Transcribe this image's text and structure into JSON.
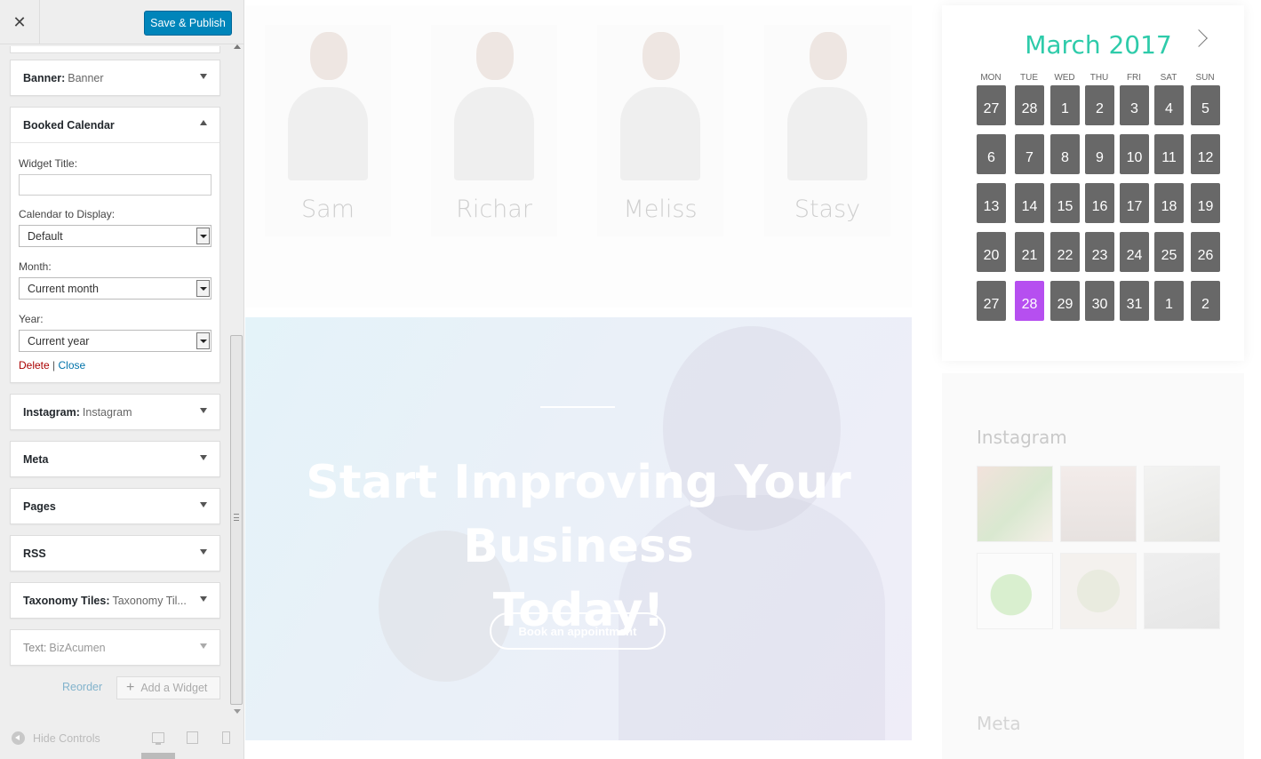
{
  "sidebar": {
    "close_symbol": "✕",
    "publish_label": "Save & Publish",
    "widgets": [
      {
        "title": "Banner:",
        "subtitle": "Banner"
      },
      {
        "title": "Booked Calendar",
        "subtitle": ""
      },
      {
        "title": "Instagram:",
        "subtitle": "Instagram"
      },
      {
        "title": "Meta",
        "subtitle": ""
      },
      {
        "title": "Pages",
        "subtitle": ""
      },
      {
        "title": "RSS",
        "subtitle": ""
      },
      {
        "title": "Taxonomy Tiles:",
        "subtitle": "Taxonomy Til..."
      },
      {
        "title": "Text:",
        "subtitle": "BizAcumen"
      }
    ],
    "booked_form": {
      "widget_title_label": "Widget Title:",
      "widget_title_value": "",
      "calendar_label": "Calendar to Display:",
      "calendar_value": "Default",
      "month_label": "Month:",
      "month_value": "Current month",
      "year_label": "Year:",
      "year_value": "Current year",
      "delete_label": "Delete",
      "separator": "|",
      "close_label": "Close"
    },
    "reorder_label": "Reorder",
    "add_widget_label": "Add a Widget",
    "add_widget_symbol": "+",
    "hide_controls_label": "Hide Controls"
  },
  "preview": {
    "team": [
      "Sam",
      "Richar",
      "Meliss",
      "Stasy"
    ],
    "hero": {
      "title_line1": "Start Improving Your Business",
      "title_line2": "Today!",
      "button_label": "Book an appointment"
    },
    "calendar": {
      "month_title": "March 2017",
      "weekdays": [
        "MON",
        "TUE",
        "WED",
        "THU",
        "FRI",
        "SAT",
        "SUN"
      ],
      "weeks": [
        [
          "27",
          "28",
          "1",
          "2",
          "3",
          "4",
          "5"
        ],
        [
          "6",
          "7",
          "8",
          "9",
          "10",
          "11",
          "12"
        ],
        [
          "13",
          "14",
          "15",
          "16",
          "17",
          "18",
          "19"
        ],
        [
          "20",
          "21",
          "22",
          "23",
          "24",
          "25",
          "26"
        ],
        [
          "27",
          "28",
          "29",
          "30",
          "31",
          "1",
          "2"
        ]
      ],
      "selected_day": "28",
      "selected_color": "#b64ff0",
      "day_color": "#686868",
      "title_color": "#2ecbaa"
    },
    "instagram_title": "Instagram",
    "meta_title": "Meta"
  },
  "colors": {
    "publish": "#0085ba",
    "delete": "#aa0000",
    "link": "#0073aa"
  }
}
